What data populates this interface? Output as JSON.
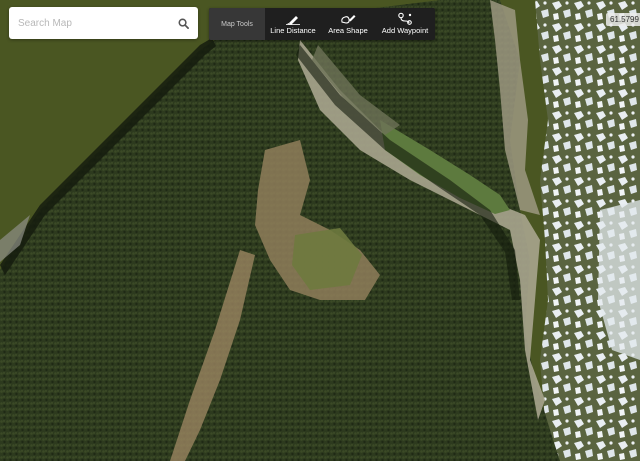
{
  "search": {
    "placeholder": "Search Map",
    "icon": "search-icon"
  },
  "map_tools": {
    "title": "Map Tools",
    "buttons": [
      {
        "label": "Line Distance",
        "icon": "pencil-icon"
      },
      {
        "label": "Area Shape",
        "icon": "area-pencil-icon"
      },
      {
        "label": "Add Waypoint",
        "icon": "waypoint-icon"
      }
    ]
  },
  "coordinates": {
    "readout": "61.5799"
  },
  "colors": {
    "river": "#4a5622",
    "forest": "#2f3a1f",
    "sandbar": "#b9b39a",
    "ice": "#e6ebef",
    "toolbar": "#1f1f1f"
  }
}
